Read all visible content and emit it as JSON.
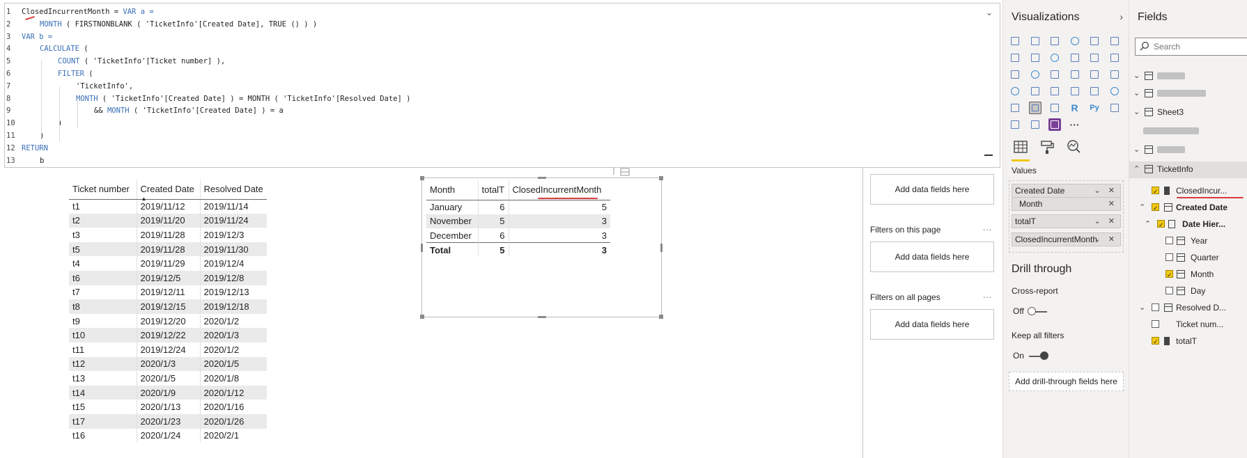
{
  "editor": {
    "line_numbers": [
      "1",
      "2",
      "3",
      "4",
      "5",
      "6",
      "7",
      "8",
      "9",
      "10",
      "11",
      "12",
      "13"
    ],
    "lines": [
      {
        "plain": "ClosedIncurrentMonth = ",
        "kw": "VAR a =",
        "rest": ""
      },
      {
        "plain": "",
        "kw": "MONTH",
        "rest": " ( FIRSTNONBLANK ( 'TicketInfo'[Created Date], TRUE () ) )"
      },
      {
        "plain": "",
        "kw": "VAR b =",
        "rest": ""
      },
      {
        "plain": "",
        "kw": "CALCULATE",
        "rest": " ("
      },
      {
        "plain": "",
        "kw": "COUNT",
        "rest": " ( 'TicketInfo'[Ticket number] ),"
      },
      {
        "plain": "",
        "kw": "FILTER",
        "rest": " ("
      },
      {
        "plain": "'TicketInfo',",
        "kw": "",
        "rest": ""
      },
      {
        "plain": "",
        "kw": "MONTH",
        "rest": " ( 'TicketInfo'[Created Date] ) = MONTH ( 'TicketInfo'[Resolved Date] )"
      },
      {
        "plain": "&& ",
        "kw": "MONTH",
        "rest": " ( 'TicketInfo'[Created Date] ) = a"
      },
      {
        "plain": ")",
        "kw": "",
        "rest": ""
      },
      {
        "plain": ")",
        "kw": "",
        "rest": ""
      },
      {
        "plain": "",
        "kw": "RETURN",
        "rest": ""
      },
      {
        "plain": "b",
        "kw": "",
        "rest": ""
      }
    ]
  },
  "ticket_table": {
    "headers": [
      "Ticket number",
      "Created Date",
      "Resolved Date"
    ],
    "rows": [
      [
        "t1",
        "2019/11/12",
        "2019/11/14"
      ],
      [
        "t2",
        "2019/11/20",
        "2019/11/24"
      ],
      [
        "t3",
        "2019/11/28",
        "2019/12/3"
      ],
      [
        "t5",
        "2019/11/28",
        "2019/11/30"
      ],
      [
        "t4",
        "2019/11/29",
        "2019/12/4"
      ],
      [
        "t6",
        "2019/12/5",
        "2019/12/8"
      ],
      [
        "t7",
        "2019/12/11",
        "2019/12/13"
      ],
      [
        "t8",
        "2019/12/15",
        "2019/12/18"
      ],
      [
        "t9",
        "2019/12/20",
        "2020/1/2"
      ],
      [
        "t10",
        "2019/12/22",
        "2020/1/3"
      ],
      [
        "t11",
        "2019/12/24",
        "2020/1/2"
      ],
      [
        "t12",
        "2020/1/3",
        "2020/1/5"
      ],
      [
        "t13",
        "2020/1/5",
        "2020/1/8"
      ],
      [
        "t14",
        "2020/1/9",
        "2020/1/12"
      ],
      [
        "t15",
        "2020/1/13",
        "2020/1/16"
      ],
      [
        "t17",
        "2020/1/23",
        "2020/1/26"
      ],
      [
        "t16",
        "2020/1/24",
        "2020/2/1"
      ]
    ]
  },
  "matrix": {
    "headers": [
      "Month",
      "totalT",
      "ClosedIncurrentMonth"
    ],
    "rows": [
      [
        "January",
        "6",
        "5"
      ],
      [
        "November",
        "5",
        "3"
      ],
      [
        "December",
        "6",
        "3"
      ]
    ],
    "total": [
      "Total",
      "5",
      "3"
    ]
  },
  "filters": {
    "add_fields_label": "Add data fields here",
    "on_this_page": "Filters on this page",
    "on_all_pages": "Filters on all pages",
    "more": "..."
  },
  "visualizations": {
    "title": "Visualizations",
    "values_label": "Values",
    "value_fields": [
      {
        "label": "Created Date",
        "controls": "⌄ ✕"
      },
      {
        "label": "Month",
        "controls": "✕"
      },
      {
        "label": "totalT",
        "controls": "⌄ ✕"
      },
      {
        "label": "ClosedIncurrentMonth",
        "controls": "⌄ ✕"
      }
    ],
    "icon_text": {
      "r": "R",
      "py": "Py",
      "more": "···"
    },
    "drill_through": "Drill through",
    "cross_report": "Cross-report",
    "cross_report_state": "Off",
    "keep_all_filters": "Keep all filters",
    "keep_all_filters_state": "On",
    "add_drill_fields": "Add drill-through fields here"
  },
  "fields": {
    "title": "Fields",
    "search_placeholder": "Search",
    "tree": {
      "table3": "Sheet3",
      "ticketinfo": "TicketInfo",
      "closed": "ClosedIncur...",
      "created": "Created Date",
      "hier": "Date Hier...",
      "year": "Year",
      "quarter": "Quarter",
      "month": "Month",
      "day": "Day",
      "resolved": "Resolved D...",
      "ticketnum": "Ticket num...",
      "totalt": "totalT"
    }
  },
  "colors": {
    "accent_yellow": "#f2c811",
    "keyword_blue": "#3a6fb8",
    "annotation_red": "#d83b3b",
    "pane_bg": "#f3f2f1"
  }
}
